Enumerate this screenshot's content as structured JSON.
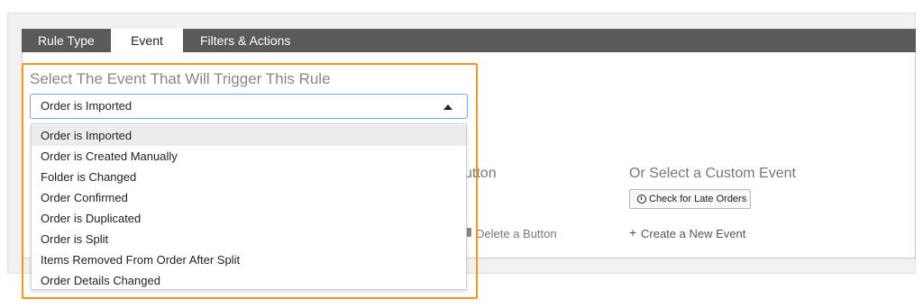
{
  "tabs": [
    {
      "label": "Rule Type"
    },
    {
      "label": "Event"
    },
    {
      "label": "Filters & Actions"
    }
  ],
  "active_tab_index": 1,
  "event_section": {
    "heading": "Select The Event That Will Trigger This Rule",
    "select_value": "Order is Imported",
    "options": [
      "Order is Imported",
      "Order is Created Manually",
      "Folder is Changed",
      "Order Confirmed",
      "Order is Duplicated",
      "Order is Split",
      "Items Removed From Order After Split",
      "Order Details Changed"
    ],
    "selected_index": 0
  },
  "button_section": {
    "partial_title": "utton",
    "delete_label": "Delete a Button"
  },
  "custom_event_section": {
    "title": "Or Select a Custom Event",
    "check_button_label": "Check for Late Orders",
    "create_label": "Create a New Event"
  },
  "colors": {
    "highlight_border": "#f7941d",
    "tab_bar_bg": "#5a5a5a",
    "select_focus_border": "#6fa7e6"
  },
  "icons": [
    "caret-up-icon",
    "clock-icon",
    "plus-icon",
    "trash-icon"
  ]
}
